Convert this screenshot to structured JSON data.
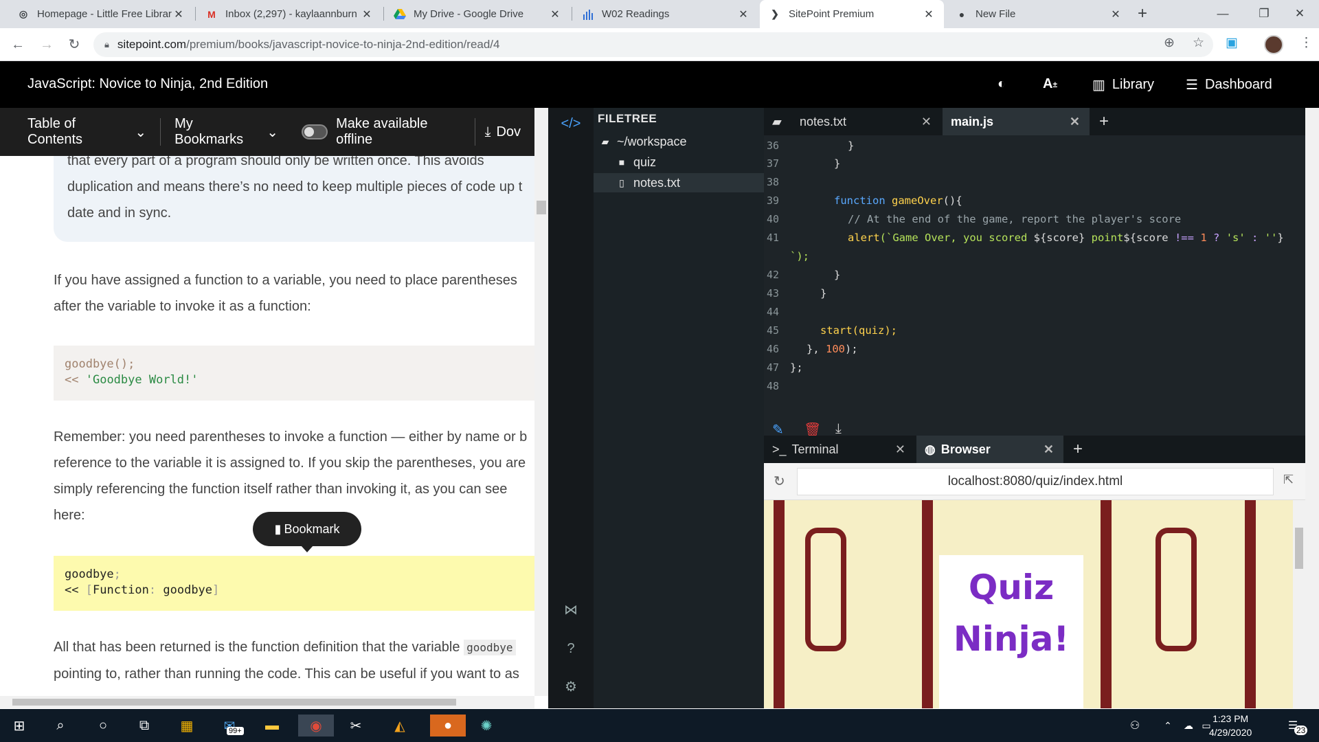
{
  "tabs": [
    {
      "title": "Homepage - Little Free Librar",
      "icon": "globe-icon"
    },
    {
      "title": "Inbox (2,297) - kaylaannburn",
      "icon": "gmail-icon"
    },
    {
      "title": "My Drive - Google Drive",
      "icon": "drive-icon"
    },
    {
      "title": "W02 Readings",
      "icon": "bar-chart-icon"
    },
    {
      "title": "SitePoint Premium",
      "icon": "sitepoint-icon"
    },
    {
      "title": "New File",
      "icon": "github-icon"
    }
  ],
  "address_bar": {
    "host": "sitepoint.com",
    "path": "/premium/books/javascript-novice-to-ninja-2nd-edition/read/4"
  },
  "site_header": {
    "title": "JavaScript: Novice to Ninja, 2nd Edition",
    "font_size_label": "A",
    "library": "Library",
    "dashboard": "Dashboard"
  },
  "book_bar": {
    "toc": "Table of Contents",
    "bookmarks": "My Bookmarks",
    "offline": "Make available offline",
    "download": "Dov"
  },
  "article": {
    "note_lines": [
      "that every part of a program should only be written once. This avoids",
      "duplication and means there’s no need to keep multiple pieces of code up t",
      "date and in sync."
    ],
    "para1_lines": [
      "If you have assigned a function to a variable, you need to place parentheses",
      "after the variable to invoke it as a function:"
    ],
    "code1_line1": "goodbye();",
    "code1_prompt": "<<",
    "code1_str": "'Goodbye World!'",
    "para2_lines": [
      "Remember: you need parentheses to invoke a function — either by name or b",
      "reference to the variable it is assigned to. If you skip the parentheses, you are",
      "simply referencing the function itself rather than invoking it, as you can see",
      "here:"
    ],
    "code2_line1": "goodbye",
    "code2_semi": ";",
    "code2_prompt": "<<",
    "code2_fn": "Function",
    "code2_name": "goodbye",
    "para3_start": "All that has been returned is the function definition that the variable",
    "para3_code": "goodbye",
    "para3_line2": "pointing to, rather than running the code. This can be useful if you want to as",
    "bookmark_tip": "Bookmark"
  },
  "ide": {
    "filetree_title": "FILETREE",
    "files": [
      {
        "name": "~/workspace",
        "icon": "folder-open-icon"
      },
      {
        "name": "quiz",
        "icon": "folder-icon"
      },
      {
        "name": "notes.txt",
        "icon": "file-icon"
      }
    ],
    "editor_tabs": [
      {
        "label": "notes.txt"
      },
      {
        "label": "main.js"
      }
    ],
    "line_numbers": [
      "36",
      "37",
      "38",
      "39",
      "40",
      "41",
      "",
      "42",
      "43",
      "44",
      "45",
      "46",
      "47",
      "48"
    ],
    "code": {
      "l36": "}",
      "l37": "}",
      "l39_kw": "function",
      "l39_fn": "gameOver",
      "l39_rest": "(){",
      "l40": "// At the end of the game, report the player's score",
      "l41_fn": "alert",
      "l41_str1": "(`Game Over, you scored ",
      "l41_tpl1": "${score}",
      "l41_str2": " point",
      "l41_tpl2": "${score",
      "l41_op": "!==",
      "l41_num": "1",
      "l41_q": "?",
      "l41_s": "'s'",
      "l41_c": ":",
      "l41_e": "''",
      "l41_close": "}",
      "l41_cont": "`);",
      "l42": "}",
      "l43": "}",
      "l45": "start(quiz);",
      "l46_a": "},",
      "l46_num": "100",
      "l46_b": ");",
      "l47": "};"
    },
    "panel_tabs": [
      {
        "label": "Terminal"
      },
      {
        "label": "Browser"
      }
    ],
    "browser_url": "localhost:8080/quiz/index.html",
    "quiz_title_1": "Quiz",
    "quiz_title_2": "Ninja!"
  },
  "taskbar": {
    "mail_badge": "99+",
    "time": "1:23 PM",
    "date": "4/29/2020",
    "notif_count": "23"
  }
}
